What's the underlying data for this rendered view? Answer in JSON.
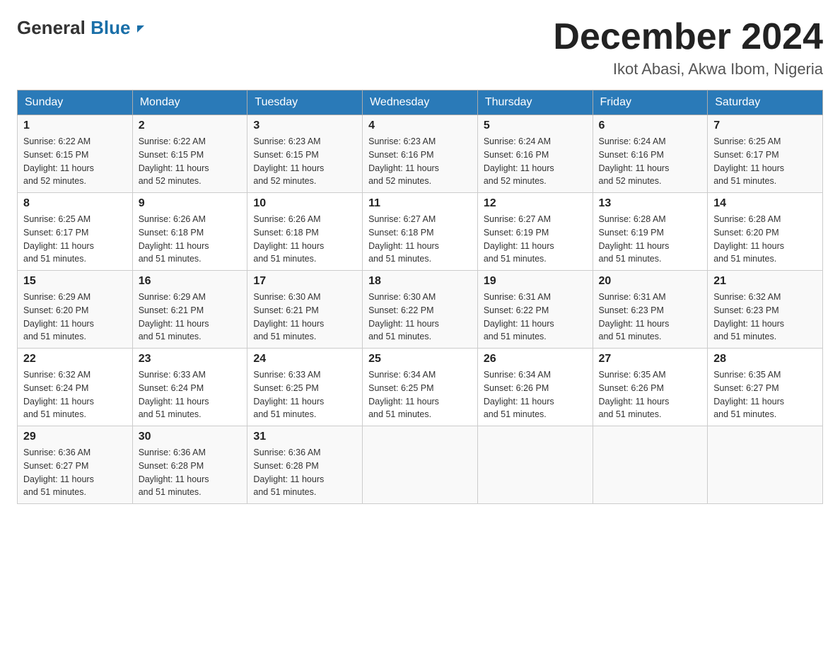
{
  "logo": {
    "general": "General",
    "blue": "Blue"
  },
  "title": {
    "month": "December 2024",
    "location": "Ikot Abasi, Akwa Ibom, Nigeria"
  },
  "days_of_week": [
    "Sunday",
    "Monday",
    "Tuesday",
    "Wednesday",
    "Thursday",
    "Friday",
    "Saturday"
  ],
  "weeks": [
    [
      {
        "day": "1",
        "sunrise": "6:22 AM",
        "sunset": "6:15 PM",
        "daylight": "11 hours and 52 minutes."
      },
      {
        "day": "2",
        "sunrise": "6:22 AM",
        "sunset": "6:15 PM",
        "daylight": "11 hours and 52 minutes."
      },
      {
        "day": "3",
        "sunrise": "6:23 AM",
        "sunset": "6:15 PM",
        "daylight": "11 hours and 52 minutes."
      },
      {
        "day": "4",
        "sunrise": "6:23 AM",
        "sunset": "6:16 PM",
        "daylight": "11 hours and 52 minutes."
      },
      {
        "day": "5",
        "sunrise": "6:24 AM",
        "sunset": "6:16 PM",
        "daylight": "11 hours and 52 minutes."
      },
      {
        "day": "6",
        "sunrise": "6:24 AM",
        "sunset": "6:16 PM",
        "daylight": "11 hours and 52 minutes."
      },
      {
        "day": "7",
        "sunrise": "6:25 AM",
        "sunset": "6:17 PM",
        "daylight": "11 hours and 51 minutes."
      }
    ],
    [
      {
        "day": "8",
        "sunrise": "6:25 AM",
        "sunset": "6:17 PM",
        "daylight": "11 hours and 51 minutes."
      },
      {
        "day": "9",
        "sunrise": "6:26 AM",
        "sunset": "6:18 PM",
        "daylight": "11 hours and 51 minutes."
      },
      {
        "day": "10",
        "sunrise": "6:26 AM",
        "sunset": "6:18 PM",
        "daylight": "11 hours and 51 minutes."
      },
      {
        "day": "11",
        "sunrise": "6:27 AM",
        "sunset": "6:18 PM",
        "daylight": "11 hours and 51 minutes."
      },
      {
        "day": "12",
        "sunrise": "6:27 AM",
        "sunset": "6:19 PM",
        "daylight": "11 hours and 51 minutes."
      },
      {
        "day": "13",
        "sunrise": "6:28 AM",
        "sunset": "6:19 PM",
        "daylight": "11 hours and 51 minutes."
      },
      {
        "day": "14",
        "sunrise": "6:28 AM",
        "sunset": "6:20 PM",
        "daylight": "11 hours and 51 minutes."
      }
    ],
    [
      {
        "day": "15",
        "sunrise": "6:29 AM",
        "sunset": "6:20 PM",
        "daylight": "11 hours and 51 minutes."
      },
      {
        "day": "16",
        "sunrise": "6:29 AM",
        "sunset": "6:21 PM",
        "daylight": "11 hours and 51 minutes."
      },
      {
        "day": "17",
        "sunrise": "6:30 AM",
        "sunset": "6:21 PM",
        "daylight": "11 hours and 51 minutes."
      },
      {
        "day": "18",
        "sunrise": "6:30 AM",
        "sunset": "6:22 PM",
        "daylight": "11 hours and 51 minutes."
      },
      {
        "day": "19",
        "sunrise": "6:31 AM",
        "sunset": "6:22 PM",
        "daylight": "11 hours and 51 minutes."
      },
      {
        "day": "20",
        "sunrise": "6:31 AM",
        "sunset": "6:23 PM",
        "daylight": "11 hours and 51 minutes."
      },
      {
        "day": "21",
        "sunrise": "6:32 AM",
        "sunset": "6:23 PM",
        "daylight": "11 hours and 51 minutes."
      }
    ],
    [
      {
        "day": "22",
        "sunrise": "6:32 AM",
        "sunset": "6:24 PM",
        "daylight": "11 hours and 51 minutes."
      },
      {
        "day": "23",
        "sunrise": "6:33 AM",
        "sunset": "6:24 PM",
        "daylight": "11 hours and 51 minutes."
      },
      {
        "day": "24",
        "sunrise": "6:33 AM",
        "sunset": "6:25 PM",
        "daylight": "11 hours and 51 minutes."
      },
      {
        "day": "25",
        "sunrise": "6:34 AM",
        "sunset": "6:25 PM",
        "daylight": "11 hours and 51 minutes."
      },
      {
        "day": "26",
        "sunrise": "6:34 AM",
        "sunset": "6:26 PM",
        "daylight": "11 hours and 51 minutes."
      },
      {
        "day": "27",
        "sunrise": "6:35 AM",
        "sunset": "6:26 PM",
        "daylight": "11 hours and 51 minutes."
      },
      {
        "day": "28",
        "sunrise": "6:35 AM",
        "sunset": "6:27 PM",
        "daylight": "11 hours and 51 minutes."
      }
    ],
    [
      {
        "day": "29",
        "sunrise": "6:36 AM",
        "sunset": "6:27 PM",
        "daylight": "11 hours and 51 minutes."
      },
      {
        "day": "30",
        "sunrise": "6:36 AM",
        "sunset": "6:28 PM",
        "daylight": "11 hours and 51 minutes."
      },
      {
        "day": "31",
        "sunrise": "6:36 AM",
        "sunset": "6:28 PM",
        "daylight": "11 hours and 51 minutes."
      },
      null,
      null,
      null,
      null
    ]
  ],
  "labels": {
    "sunrise": "Sunrise:",
    "sunset": "Sunset:",
    "daylight": "Daylight:"
  }
}
